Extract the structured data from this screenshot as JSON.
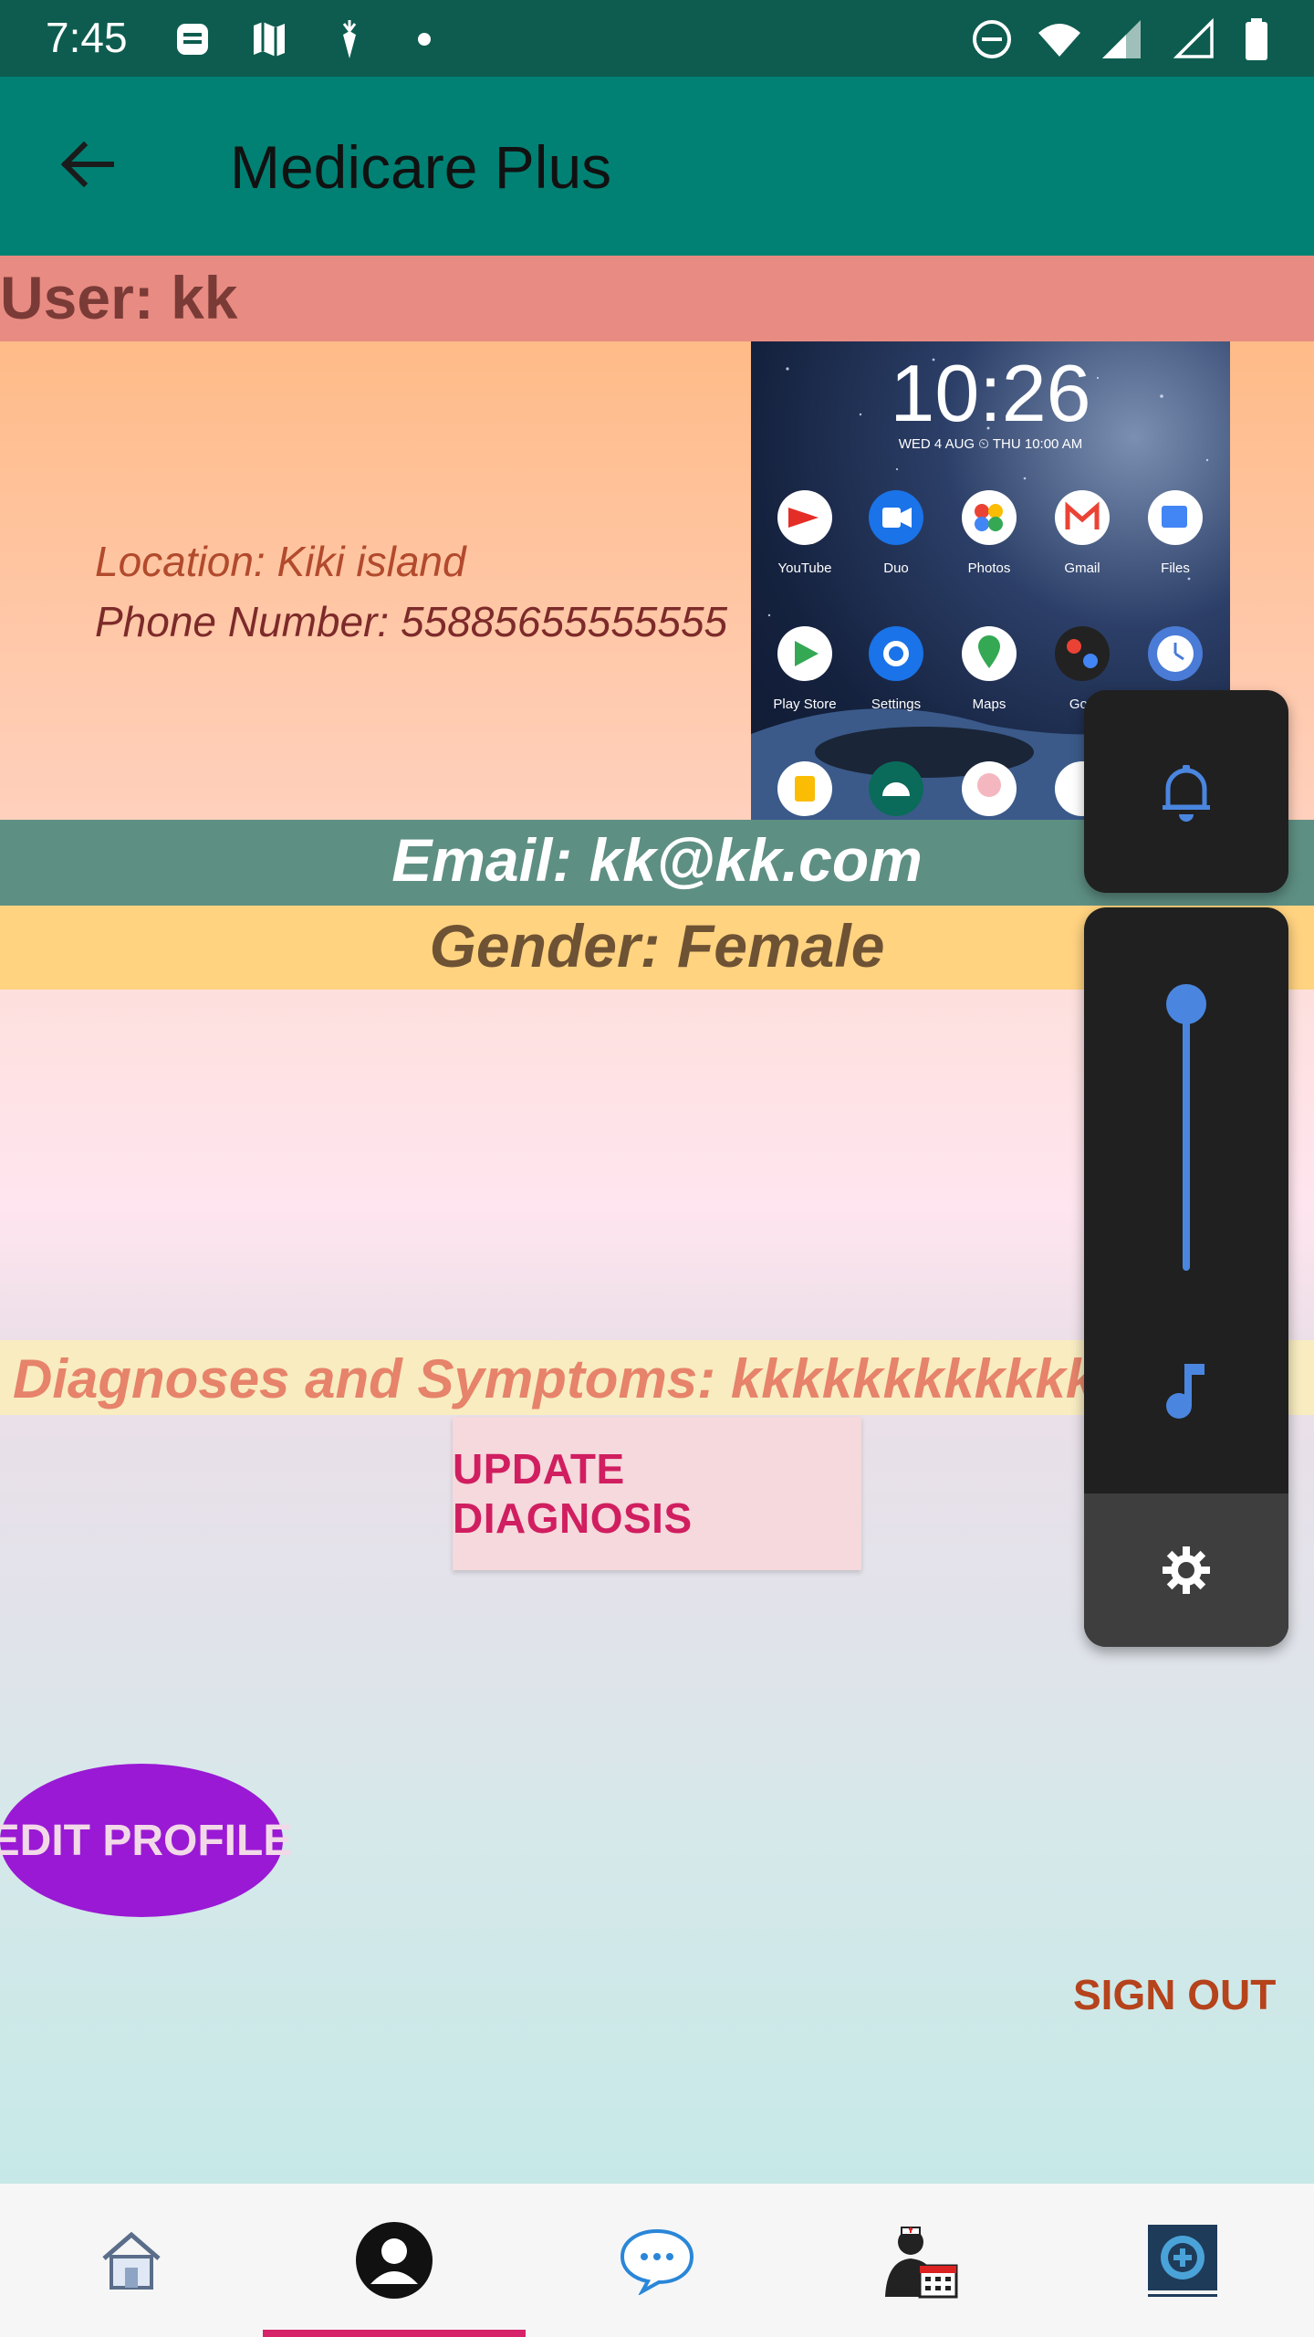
{
  "status_bar": {
    "time": "7:45",
    "icons": [
      "news-icon",
      "maps-icon",
      "carrot-icon",
      "dot-icon",
      "dnd-icon",
      "wifi-icon",
      "signal-icon",
      "signal-empty-icon",
      "battery-icon"
    ]
  },
  "app_bar": {
    "title": "Medicare Plus",
    "back_icon": "back-arrow-icon"
  },
  "profile": {
    "user": "User: kk",
    "location": "Location: Kiki island",
    "phone": "Phone Number: 55885655555555",
    "email": "Email: kk@kk.com",
    "gender": "Gender: Female",
    "diagnoses": "Diagnoses and Symptoms: kkkkkkkkkkkkkkkkkk"
  },
  "wallpaper_preview": {
    "clock": "10:26",
    "date": "WED 4 AUG ⏲ THU 10:00 AM",
    "apps_row1": [
      "YouTube",
      "Duo",
      "Photos",
      "Gmail",
      "Files"
    ],
    "apps_row2": [
      "Play Store",
      "Settings",
      "Maps",
      "Goo",
      ""
    ]
  },
  "buttons": {
    "update_diagnosis": "UPDATE DIAGNOSIS",
    "edit_profile": "EDIT PROFILE",
    "sign_out": "SIGN OUT"
  },
  "bottom_nav": {
    "items": [
      {
        "icon": "home-icon"
      },
      {
        "icon": "profile-icon"
      },
      {
        "icon": "chat-icon"
      },
      {
        "icon": "doctor-calendar-icon"
      },
      {
        "icon": "medical-settings-icon"
      }
    ],
    "selected_index": 1
  },
  "volume_panel": {
    "ringer_icon": "bell-icon",
    "media_icon": "music-note-icon",
    "settings_icon": "gear-icon",
    "level": 1.0
  },
  "colors": {
    "status_bar": "#0d5c4f",
    "app_bar": "#008174",
    "accent": "#d6246a",
    "volume_accent": "#4a86e0"
  }
}
